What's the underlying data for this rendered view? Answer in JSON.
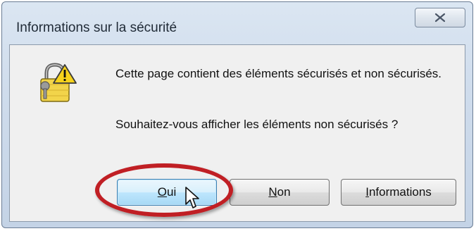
{
  "dialog": {
    "title": "Informations sur la sécurité",
    "message_line1": "Cette page contient des éléments sécurisés et non sécurisés.",
    "message_line2": "Souhaitez-vous afficher les éléments non sécurisés ?",
    "icon": "security-warning-lock-icon"
  },
  "buttons": {
    "oui_first": "O",
    "oui_rest": "ui",
    "non_first": "N",
    "non_rest": "on",
    "info_first": "I",
    "info_rest": "nformations",
    "close_icon": "close-icon"
  },
  "annotation": {
    "highlight_color": "#c01f24"
  }
}
